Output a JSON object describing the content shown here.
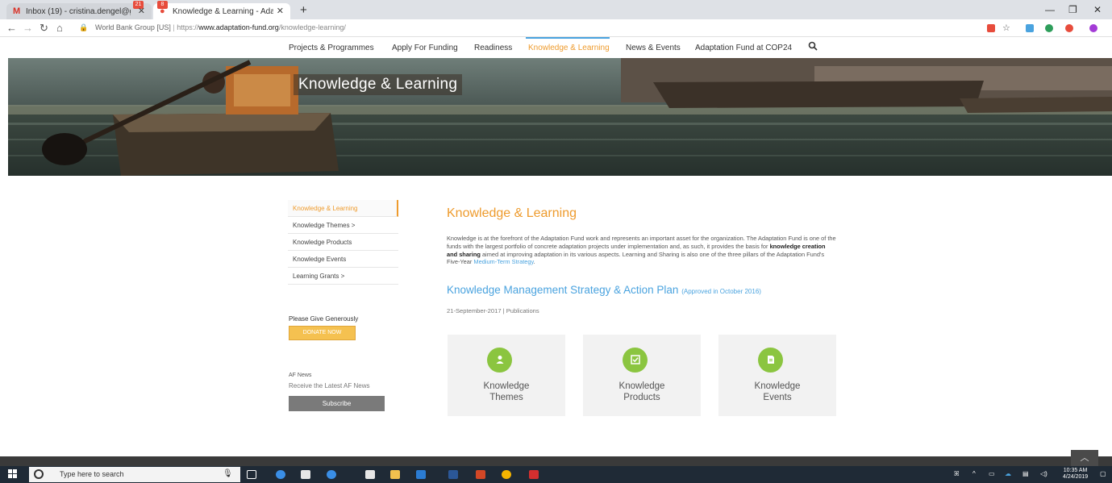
{
  "browser": {
    "tabs": [
      {
        "label": "Inbox (19) - cristina.dengel@gm",
        "badge": "21",
        "icon": "gmail-icon"
      },
      {
        "label": "Knowledge & Learning - Adaptat",
        "badge": "8",
        "icon": "favicon-icon"
      }
    ],
    "new_tab": "+",
    "secure_label": "World Bank Group [US]",
    "url_prefix": "https://",
    "url_host": "www.adaptation-fund.org",
    "url_path": "/knowledge-learning/",
    "window_controls": [
      "—",
      "❐",
      "✕"
    ]
  },
  "site_nav": {
    "items": [
      {
        "label": "Projects & Programmes"
      },
      {
        "label": "Apply For Funding"
      },
      {
        "label": "Readiness"
      },
      {
        "label": "Knowledge & Learning",
        "active": true
      },
      {
        "label": "News & Events"
      },
      {
        "label": "Adaptation Fund at COP24"
      }
    ],
    "search_icon": "search-icon"
  },
  "hero": {
    "title": "Knowledge & Learning"
  },
  "sidebar": {
    "items": [
      {
        "label": "Knowledge & Learning",
        "active": true
      },
      {
        "label": "Knowledge Themes  >"
      },
      {
        "label": "Knowledge Products"
      },
      {
        "label": "Knowledge Events"
      },
      {
        "label": "Learning Grants  >"
      }
    ],
    "give_label": "Please Give Generously",
    "donate_label": "DONATE NOW",
    "news_label": "AF News",
    "news_sub": "Receive the Latest AF News",
    "subscribe_label": "Subscribe"
  },
  "main": {
    "title": "Knowledge & Learning",
    "intro_part1": "Knowledge is at the forefront of the Adaptation Fund work and represents an important asset for the organization. The Adaptation Fund is one of the funds with the largest portfolio of concrete adaptation projects under implementation and, as such, it provides the basis for ",
    "intro_bold": "knowledge creation and sharing",
    "intro_part2": " aimed at improving adaptation in its various aspects. Learning and Sharing is also one of the three pillars of the Adaptation Fund's Five-Year ",
    "intro_link": "Medium-Term Strategy",
    "intro_end": ".",
    "strategy_title": "Knowledge Management Strategy & Action Plan",
    "strategy_note": "(Approved in October 2016)",
    "meta": "21-September-2017 | Publications",
    "cards": [
      {
        "title_line1": "Knowledge",
        "title_line2": "Themes",
        "icon": "person-icon"
      },
      {
        "title_line1": "Knowledge",
        "title_line2": "Products",
        "icon": "checkbox-icon"
      },
      {
        "title_line1": "Knowledge",
        "title_line2": "Events",
        "icon": "document-icon"
      }
    ]
  },
  "taskbar": {
    "search_placeholder": "Type here to search",
    "time": "10:35 AM",
    "date": "4/24/2019"
  },
  "colors": {
    "accent_orange": "#ee9b2d",
    "accent_blue": "#4aa3df",
    "card_green": "#8bc540",
    "donate_yellow": "#f5c150"
  }
}
